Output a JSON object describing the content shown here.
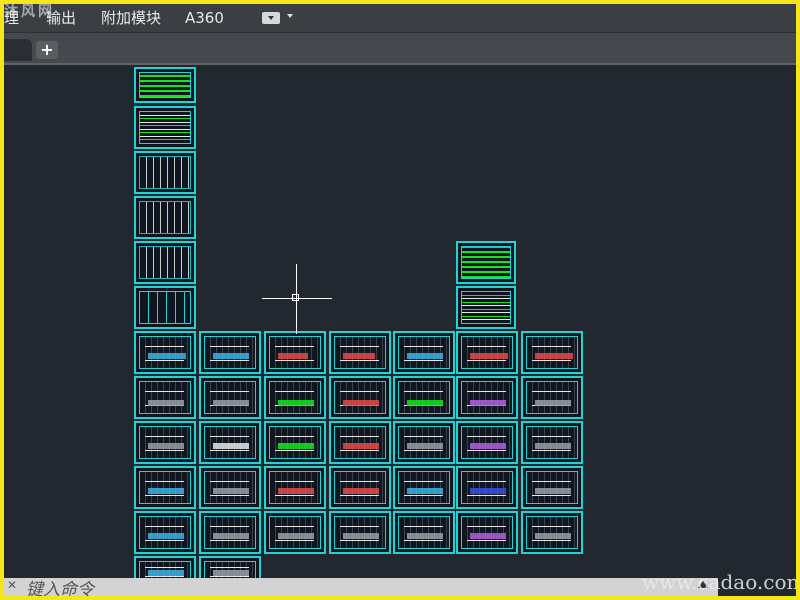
{
  "window": {
    "watermark_top_left": "沐风网",
    "watermark_bottom_right": "www.cadao.com"
  },
  "menubar": {
    "items": [
      "理",
      "输出",
      "附加模块",
      "A360"
    ],
    "dropdown_icon": "chevron-down-icon"
  },
  "tabs": {
    "add_label": "+"
  },
  "command_line": {
    "placeholder": "键入命令",
    "close_icon": "close-icon",
    "expand_icon": "caret-up-icon"
  },
  "colors": {
    "background": "#212830",
    "sheet_border": "#22d3d3",
    "highlight": "#f5e61a"
  }
}
